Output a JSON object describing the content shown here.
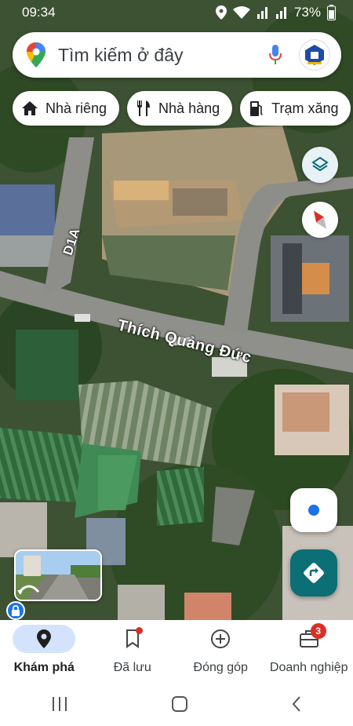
{
  "status_bar": {
    "time": "09:34",
    "battery": "73%",
    "icons": [
      "location-icon",
      "wifi-icon",
      "signal-icon",
      "signal-icon",
      "battery-icon"
    ]
  },
  "search": {
    "placeholder": "Tìm kiếm ở đây",
    "icons": [
      "maps-pin-logo",
      "mic-icon",
      "avatar"
    ]
  },
  "chips": [
    {
      "label": "Nhà riêng",
      "icon": "home-icon"
    },
    {
      "label": "Nhà hàng",
      "icon": "restaurant-icon"
    },
    {
      "label": "Trạm xăng",
      "icon": "gas-station-icon"
    }
  ],
  "map": {
    "road_labels": {
      "d1a": "D1A",
      "thich_quang_duc": "Thích Quảng Đức"
    },
    "controls": [
      "layers-icon",
      "compass-icon",
      "my-location-icon",
      "directions-icon",
      "street-view-thumbnail"
    ]
  },
  "bottom_nav": {
    "items": [
      {
        "label": "Khám phá",
        "icon": "explore-pin-icon",
        "active": true
      },
      {
        "label": "Đã lưu",
        "icon": "bookmark-icon"
      },
      {
        "label": "Đóng góp",
        "icon": "add-circle-icon"
      },
      {
        "label": "Doanh nghiệp",
        "icon": "business-icon",
        "badge": "3"
      }
    ]
  },
  "system_nav": [
    "recents-icon",
    "home-icon",
    "back-icon"
  ],
  "colors": {
    "accent": "#1a73e8",
    "directions": "#0b6f75",
    "badge": "#d93025",
    "active_pill": "#d3e3fd"
  }
}
